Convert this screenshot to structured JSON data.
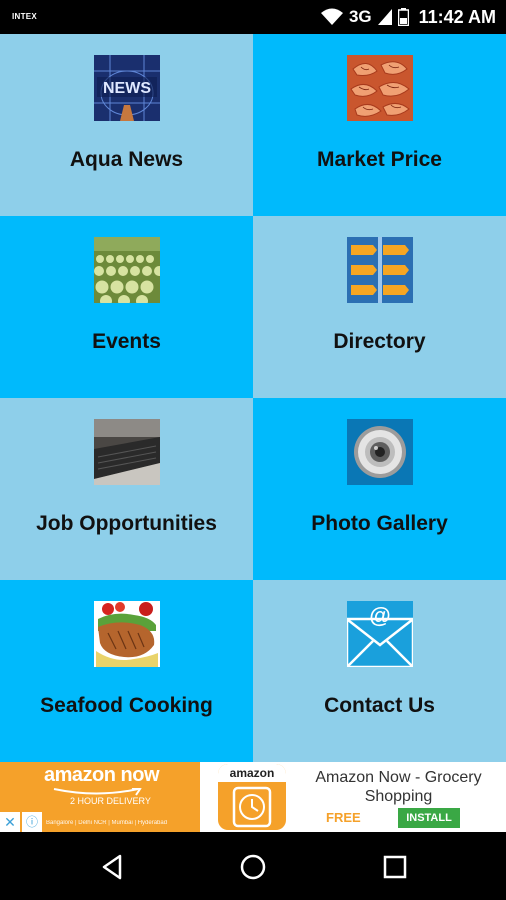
{
  "status_bar": {
    "carrier": "INTEX",
    "network": "3G",
    "time": "11:42 AM"
  },
  "menu": [
    {
      "label": "Aqua News",
      "icon": "news-icon"
    },
    {
      "label": "Market Price",
      "icon": "shrimp-icon"
    },
    {
      "label": "Events",
      "icon": "events-icon"
    },
    {
      "label": "Directory",
      "icon": "directory-icon"
    },
    {
      "label": "Job Opportunities",
      "icon": "laptop-icon"
    },
    {
      "label": "Photo Gallery",
      "icon": "camera-lens-icon"
    },
    {
      "label": "Seafood Cooking",
      "icon": "seafood-dish-icon"
    },
    {
      "label": "Contact Us",
      "icon": "email-icon"
    }
  ],
  "ad": {
    "brand": "amazon now",
    "subtitle": "2 HOUR DELIVERY",
    "cities": "Bangalore | Delhi NCR | Mumbai | Hyderabad",
    "app_brand": "amazon",
    "title": "Amazon Now - Grocery Shopping",
    "price": "FREE",
    "cta": "INSTALL"
  },
  "colors": {
    "tile_light": "#8ecfea",
    "tile_bright": "#00bafc",
    "ad_orange": "#f5a12a",
    "install_green": "#3aa845"
  }
}
